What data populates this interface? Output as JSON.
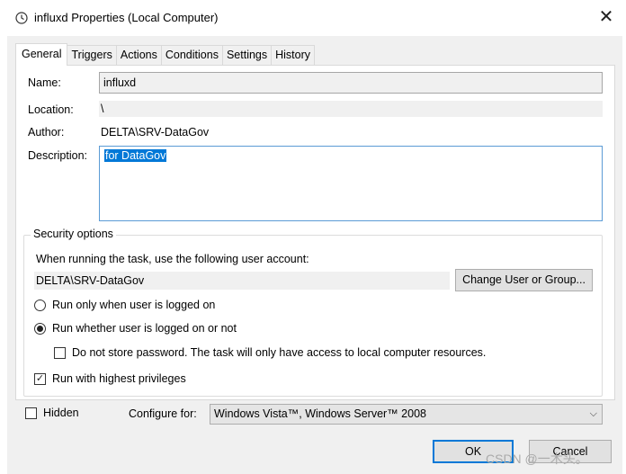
{
  "window": {
    "title": "influxd Properties (Local Computer)",
    "close_glyph": "✕"
  },
  "tabs": [
    {
      "label": "General",
      "active": true
    },
    {
      "label": "Triggers",
      "active": false
    },
    {
      "label": "Actions",
      "active": false
    },
    {
      "label": "Conditions",
      "active": false
    },
    {
      "label": "Settings",
      "active": false
    },
    {
      "label": "History",
      "active": false
    }
  ],
  "general": {
    "name_label": "Name:",
    "name_value": "influxd",
    "location_label": "Location:",
    "location_value": "\\",
    "author_label": "Author:",
    "author_value": "DELTA\\SRV-DataGov",
    "description_label": "Description:",
    "description_value": "for DataGov"
  },
  "security": {
    "legend": "Security options",
    "account_prompt": "When running the task, use the following user account:",
    "account_value": "DELTA\\SRV-DataGov",
    "change_button": "Change User or Group...",
    "radio_logged_on": "Run only when user is logged on",
    "radio_whether": "Run whether user is logged on or not",
    "radio_selected": "whether",
    "no_store_password": "Do not store password.  The task will only have access to local computer resources.",
    "no_store_checked": false,
    "highest_privileges": "Run with highest privileges",
    "highest_checked": true,
    "check_glyph": "✓"
  },
  "footer": {
    "hidden_label": "Hidden",
    "hidden_checked": false,
    "configure_label": "Configure for:",
    "configure_value": "Windows Vista™, Windows Server™ 2008",
    "chevron_glyph": "⌵",
    "ok_button": "OK",
    "cancel_button": "Cancel",
    "watermark": "CSDN @一木头。"
  },
  "colors": {
    "accent": "#0078d7",
    "selection": "#0078d7",
    "focus_border": "#5b9bd5",
    "dialog_bg": "#f0f0f0"
  }
}
